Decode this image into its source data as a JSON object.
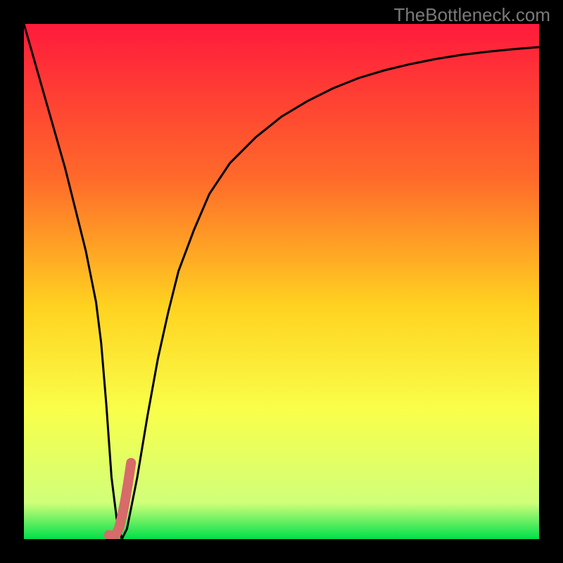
{
  "watermark": "TheBottleneck.com",
  "chart_data": {
    "type": "line",
    "title": "",
    "xlabel": "",
    "ylabel": "",
    "xlim": [
      0,
      100
    ],
    "ylim": [
      0,
      100
    ],
    "grid": false,
    "gradient_stops": [
      {
        "offset": 0,
        "color": "#ff1a3c"
      },
      {
        "offset": 30,
        "color": "#ff6a2a"
      },
      {
        "offset": 55,
        "color": "#ffd320"
      },
      {
        "offset": 75,
        "color": "#f9ff4a"
      },
      {
        "offset": 93,
        "color": "#d0ff7a"
      },
      {
        "offset": 100,
        "color": "#00e04a"
      }
    ],
    "series": [
      {
        "name": "bottleneck-curve",
        "color": "#000000",
        "width": 3,
        "x": [
          0,
          2,
          4,
          6,
          8,
          10,
          12,
          14,
          15,
          16,
          17,
          18,
          19,
          20,
          22,
          24,
          26,
          28,
          30,
          33,
          36,
          40,
          45,
          50,
          55,
          60,
          65,
          70,
          75,
          80,
          85,
          90,
          95,
          100
        ],
        "values": [
          100,
          93,
          86,
          79,
          72,
          64,
          56,
          46,
          38,
          26,
          12,
          4,
          0,
          2,
          12,
          24,
          35,
          44,
          52,
          60,
          67,
          73,
          78,
          82,
          85,
          87.5,
          89.5,
          91,
          92.2,
          93.2,
          94,
          94.6,
          95.1,
          95.5
        ]
      },
      {
        "name": "highlight-segment",
        "color": "#d86a6a",
        "width": 14,
        "linecap": "round",
        "x": [
          16.5,
          17.2,
          17.8,
          18.4,
          19.0,
          19.6,
          20.2,
          20.8
        ],
        "values": [
          0.8,
          0.5,
          0.8,
          2.0,
          4.2,
          7.2,
          10.8,
          14.8
        ]
      }
    ]
  }
}
